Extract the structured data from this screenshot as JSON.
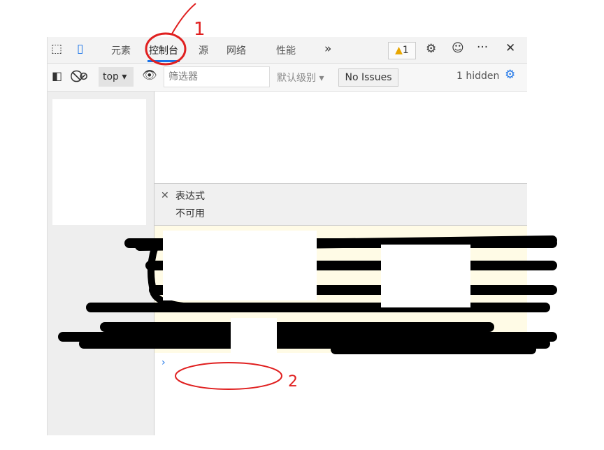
{
  "toolbar": {
    "tabs": [
      {
        "label": "元素",
        "active": false
      },
      {
        "label": "控制台",
        "active": true
      },
      {
        "label": "源",
        "active": false
      },
      {
        "label": "网络",
        "active": false
      },
      {
        "label": "性能",
        "active": false
      }
    ],
    "more_tabs_icon": "»",
    "warning_count": "1",
    "icons": [
      "inspect-icon",
      "device-toolbar-icon",
      "settings-icon",
      "feedback-icon",
      "more-icon",
      "close-icon"
    ]
  },
  "console_toolbar": {
    "context": "top",
    "filter_placeholder": "筛选器",
    "level": "默认级别",
    "issues": "No Issues",
    "hidden": "1 hidden"
  },
  "expression": {
    "label": "表达式",
    "value": "不可用"
  },
  "annotations": {
    "label_1": "1",
    "label_2": "2",
    "color": "#e02020"
  }
}
